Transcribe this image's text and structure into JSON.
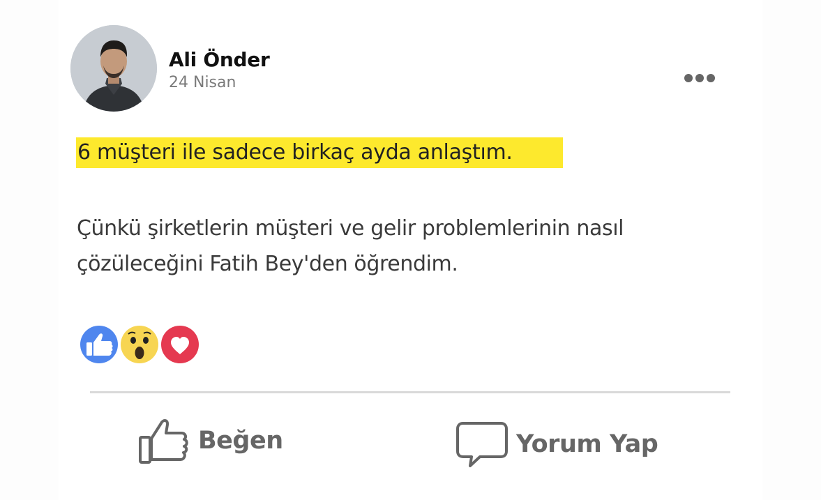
{
  "post": {
    "author_name": "Ali Önder",
    "date": "24 Nisan",
    "headline": "6 müşteri ile sadece birkaç ayda anlaştım.",
    "body_lines": [
      "Çünkü şirketlerin müşteri ve gelir problemlerinin nasıl",
      "çözüleceğini Fatih Bey'den öğrendim."
    ],
    "highlight_color": "#fde92d",
    "reactions": [
      "like-icon",
      "wow-icon",
      "love-icon"
    ]
  },
  "actions": {
    "like_label": "Beğen",
    "comment_label": "Yorum Yap"
  },
  "colors": {
    "like_blue": "#4f86ee",
    "wow_yellow": "#f7d552",
    "love_red": "#e53950",
    "action_gray": "#666666"
  }
}
